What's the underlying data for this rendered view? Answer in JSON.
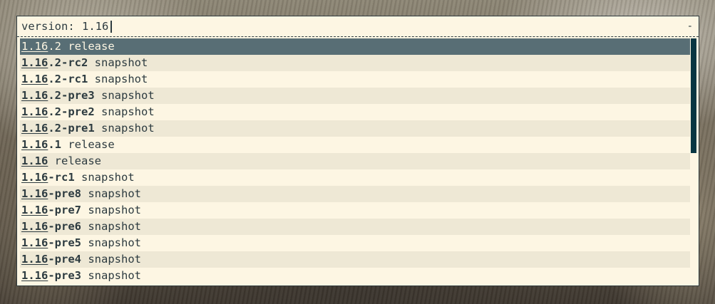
{
  "prompt": {
    "label": "version:",
    "value": "1.16",
    "minimize": "-"
  },
  "candidates": [
    {
      "match": "1.16",
      "rest": ".2",
      "desc": "release"
    },
    {
      "match": "1.16",
      "rest": ".2-rc2",
      "desc": "snapshot"
    },
    {
      "match": "1.16",
      "rest": ".2-rc1",
      "desc": "snapshot"
    },
    {
      "match": "1.16",
      "rest": ".2-pre3",
      "desc": "snapshot"
    },
    {
      "match": "1.16",
      "rest": ".2-pre2",
      "desc": "snapshot"
    },
    {
      "match": "1.16",
      "rest": ".2-pre1",
      "desc": "snapshot"
    },
    {
      "match": "1.16",
      "rest": ".1",
      "desc": "release"
    },
    {
      "match": "1.16",
      "rest": "",
      "desc": "release"
    },
    {
      "match": "1.16",
      "rest": "-rc1",
      "desc": "snapshot"
    },
    {
      "match": "1.16",
      "rest": "-pre8",
      "desc": "snapshot"
    },
    {
      "match": "1.16",
      "rest": "-pre7",
      "desc": "snapshot"
    },
    {
      "match": "1.16",
      "rest": "-pre6",
      "desc": "snapshot"
    },
    {
      "match": "1.16",
      "rest": "-pre5",
      "desc": "snapshot"
    },
    {
      "match": "1.16",
      "rest": "-pre4",
      "desc": "snapshot"
    },
    {
      "match": "1.16",
      "rest": "-pre3",
      "desc": "snapshot"
    }
  ],
  "selected_index": 0
}
